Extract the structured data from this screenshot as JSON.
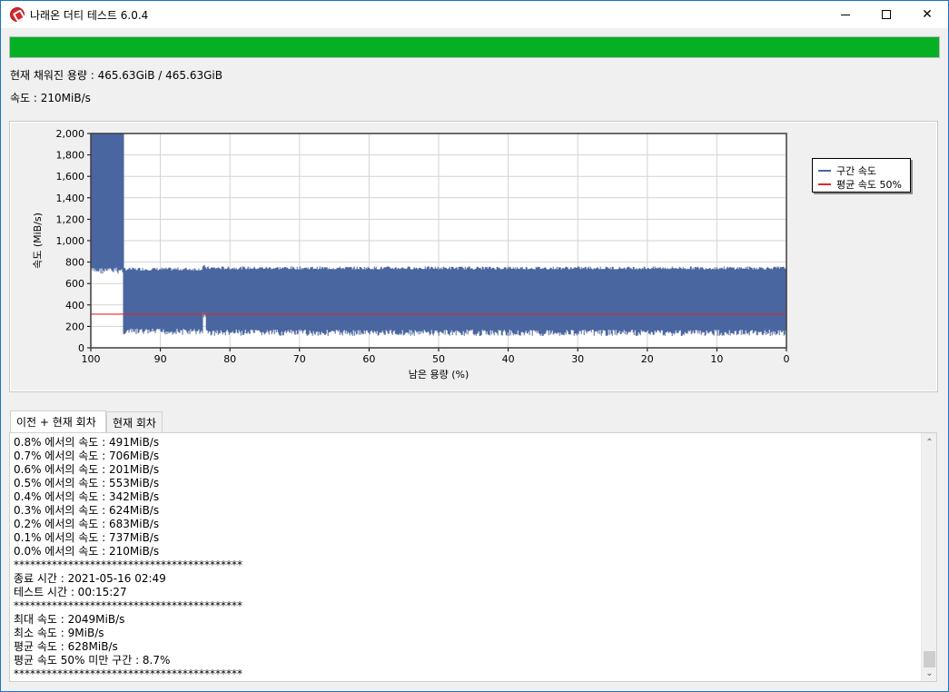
{
  "window": {
    "title": "나래온 더티 테스트 6.0.4",
    "min_icon": "minimize-icon",
    "max_icon": "maximize-icon",
    "close_icon": "close-icon",
    "close_glyph": "✕"
  },
  "progress": {
    "value_fraction": 1.0,
    "color": "#06b025"
  },
  "status": {
    "filled_line": "현재 채워진 용량 : 465.63GiB / 465.63GiB",
    "speed_line": "속도 : 210MiB/s"
  },
  "chart_data": {
    "type": "area",
    "xlabel": "남은 용량 (%)",
    "ylabel": "속도 (MiB/s)",
    "xlim": [
      100,
      0
    ],
    "ylim": [
      0,
      2000
    ],
    "x_ticks": [
      "100",
      "90",
      "80",
      "70",
      "60",
      "50",
      "40",
      "30",
      "20",
      "10",
      "0"
    ],
    "y_ticks": [
      "0",
      "200",
      "400",
      "600",
      "800",
      "1,000",
      "1,200",
      "1,400",
      "1,600",
      "1,800",
      "2,000"
    ],
    "grid": true,
    "legend_position": "right",
    "series": [
      {
        "name": "구간 속도",
        "color": "#4a66a0",
        "segments": [
          {
            "x_start": 100,
            "x_end": 95.3,
            "y_low": 750,
            "y_high": 2049
          },
          {
            "x_start": 95.3,
            "x_end": 83.9,
            "y_low": 180,
            "y_high": 720
          },
          {
            "x_start": 83.9,
            "x_end": 83.4,
            "y_low": 340,
            "y_high": 740
          },
          {
            "x_start": 83.4,
            "x_end": 0,
            "y_low": 170,
            "y_high": 730
          }
        ]
      },
      {
        "name": "평균 속도 50%",
        "color": "#e0282a",
        "value": 314
      }
    ]
  },
  "tabs": [
    {
      "label": "이전 + 현재 회차",
      "active": true
    },
    {
      "label": "현재 회차",
      "active": false
    }
  ],
  "log": [
    "0.8% 에서의 속도 : 491MiB/s",
    "0.7% 에서의 속도 : 706MiB/s",
    "0.6% 에서의 속도 : 201MiB/s",
    "0.5% 에서의 속도 : 553MiB/s",
    "0.4% 에서의 속도 : 342MiB/s",
    "0.3% 에서의 속도 : 624MiB/s",
    "0.2% 에서의 속도 : 683MiB/s",
    "0.1% 에서의 속도 : 737MiB/s",
    "0.0% 에서의 속도 : 210MiB/s",
    "******************************************",
    "종료 시간 : 2021-05-16 02:49",
    "테스트 시간 : 00:15:27",
    "******************************************",
    "최대 속도 : 2049MiB/s",
    "최소 속도 : 9MiB/s",
    "평균 속도 : 628MiB/s",
    "평균 속도 50% 미만 구간 : 8.7%",
    "******************************************"
  ],
  "scrollbar": {
    "up_glyph": "⌃",
    "down_glyph": "⌄"
  }
}
